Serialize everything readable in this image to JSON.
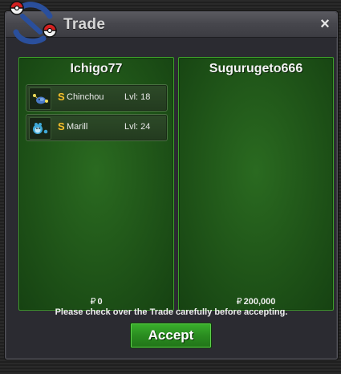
{
  "window": {
    "title": "Trade",
    "close_label": "×"
  },
  "left_panel": {
    "player": "Ichigo77",
    "items": [
      {
        "coin": "S",
        "name": "Chinchou",
        "level": "Lvl: 18",
        "icon": "chinchou-icon"
      },
      {
        "coin": "S",
        "name": "Marill",
        "level": "Lvl: 24",
        "icon": "marill-icon"
      }
    ],
    "currency_symbol": "₽",
    "money": "0"
  },
  "right_panel": {
    "player": "Sugurugeto666",
    "currency_symbol": "₽",
    "money": "200,000"
  },
  "footer": {
    "note": "Please check over the Trade carefully before accepting.",
    "accept_label": "Accept"
  },
  "colors": {
    "panel_green": "#1f5418",
    "panel_border": "#3ea02a",
    "accept_green": "#2a8c20",
    "shiny_gold": "#f0c030"
  }
}
